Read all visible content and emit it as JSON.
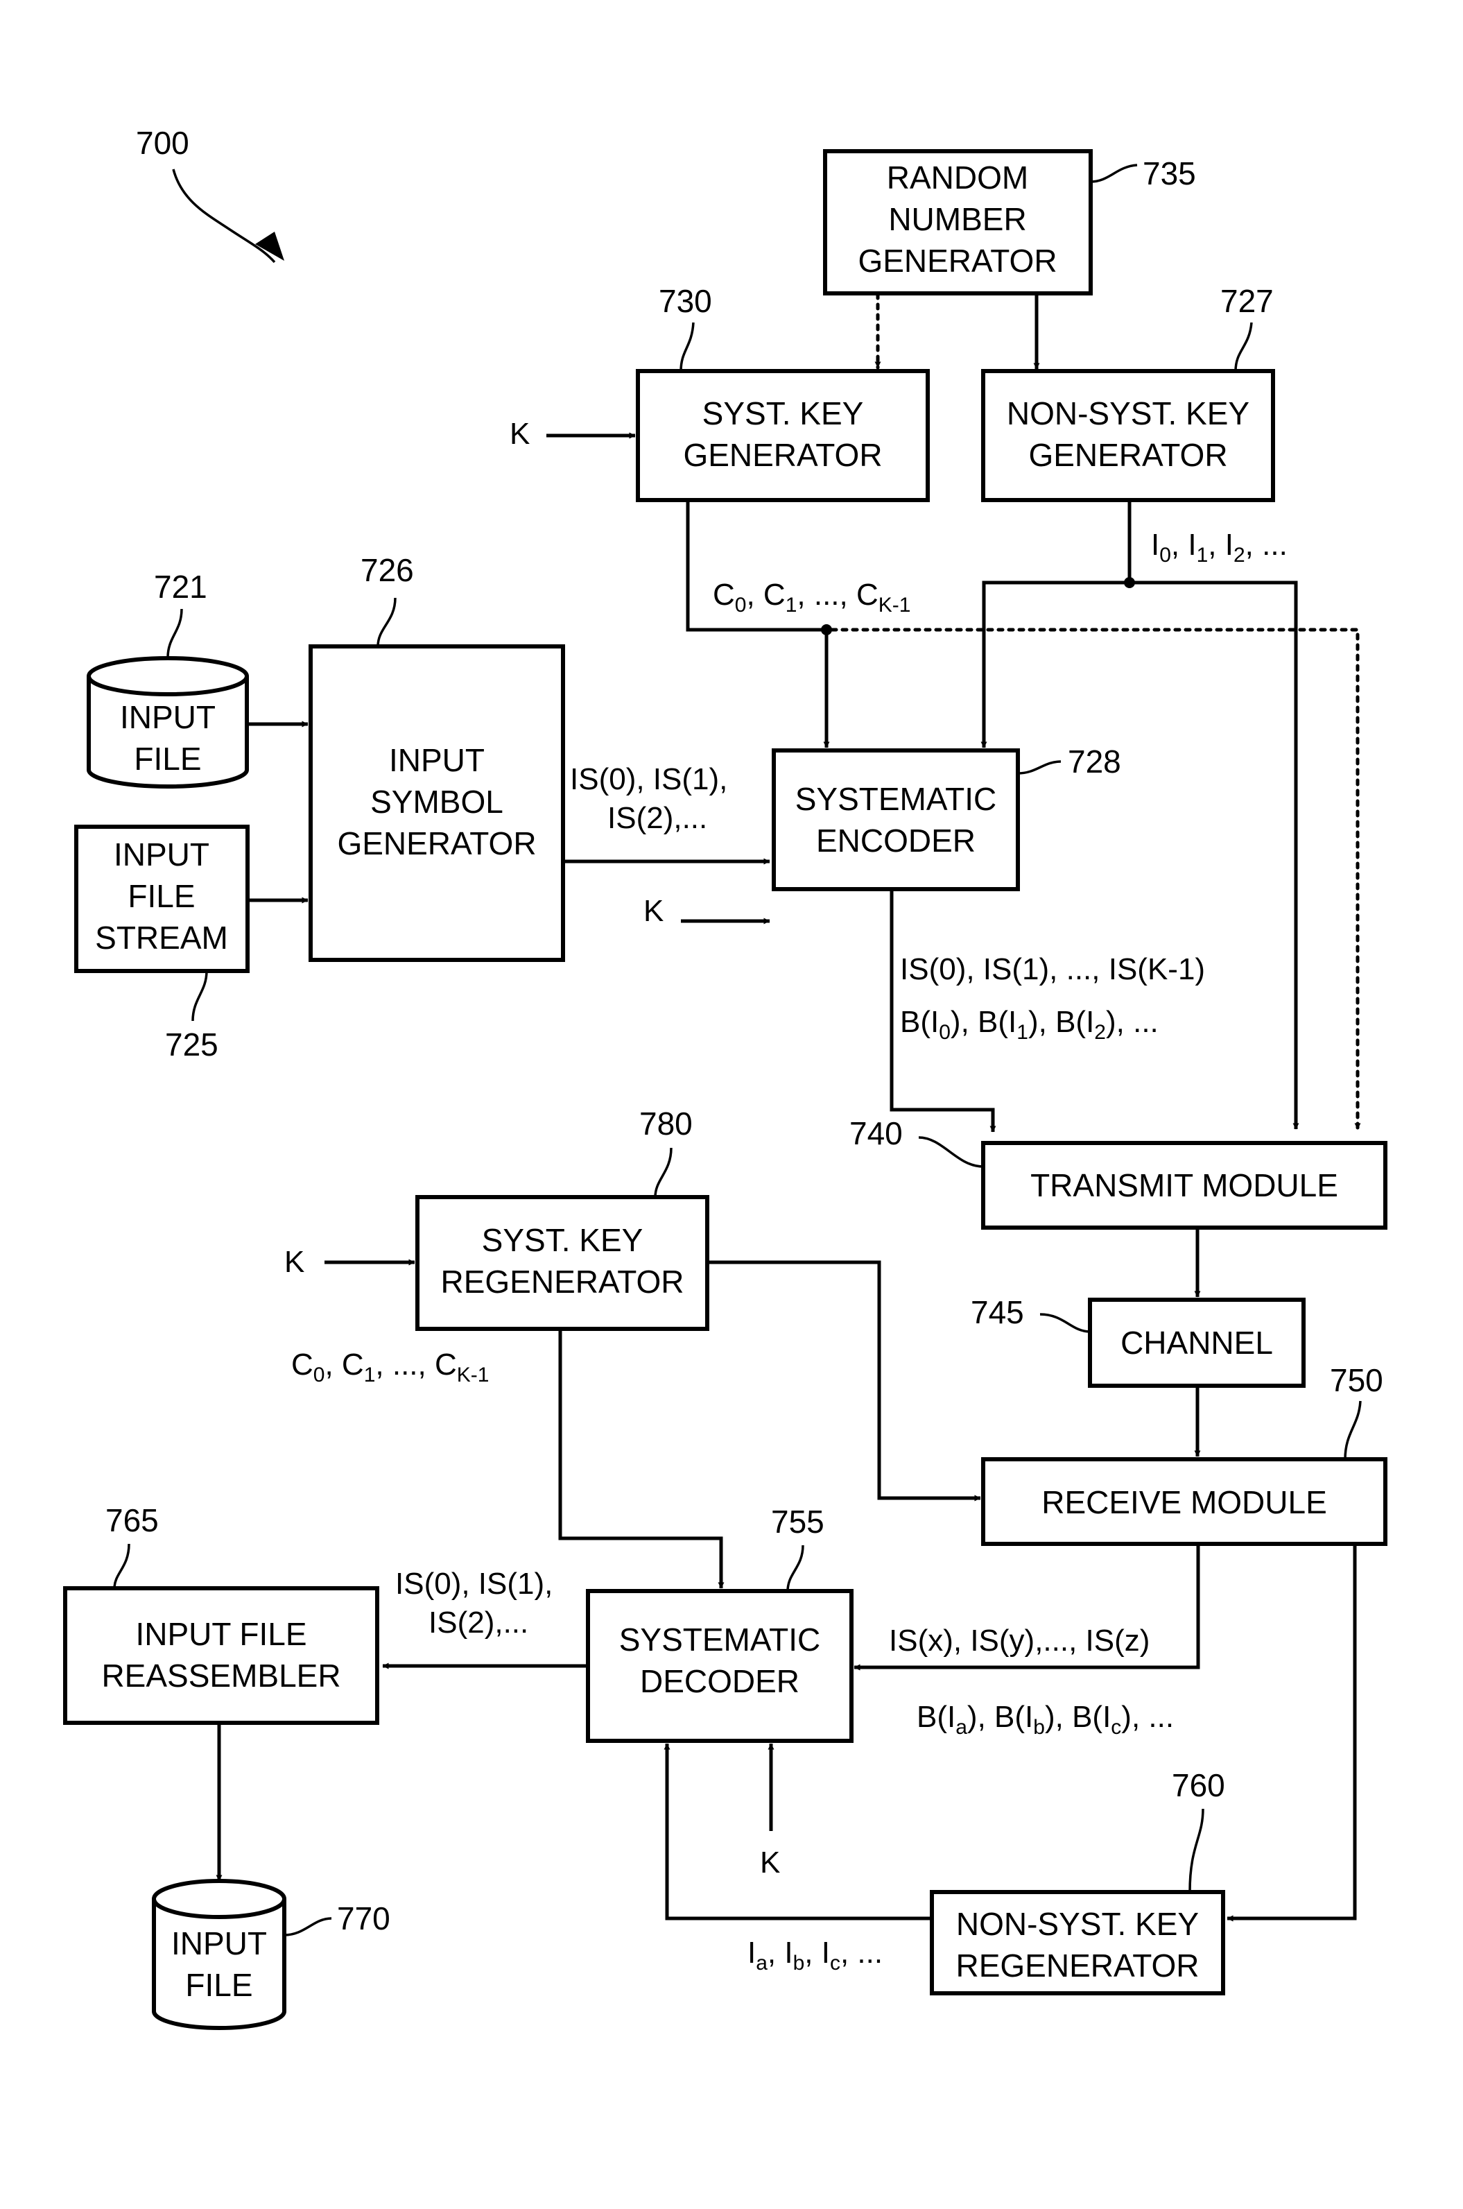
{
  "figure": {
    "ref": "700",
    "colors": {
      "ink": "#000000",
      "background": "#ffffff"
    }
  },
  "blocks": {
    "random_number_generator": {
      "ref": "735",
      "lines": [
        "RANDOM",
        "NUMBER",
        "GENERATOR"
      ]
    },
    "syst_key_generator": {
      "ref": "730",
      "lines": [
        "SYST. KEY",
        "GENERATOR"
      ]
    },
    "non_syst_key_generator": {
      "ref": "727",
      "lines": [
        "NON-SYST. KEY",
        "GENERATOR"
      ]
    },
    "input_file": {
      "ref": "721",
      "lines": [
        "INPUT",
        "FILE"
      ]
    },
    "input_file_stream": {
      "ref": "725",
      "lines": [
        "INPUT",
        "FILE",
        "STREAM"
      ]
    },
    "input_symbol_generator": {
      "ref": "726",
      "lines": [
        "INPUT",
        "SYMBOL",
        "GENERATOR"
      ]
    },
    "systematic_encoder": {
      "ref": "728",
      "lines": [
        "SYSTEMATIC",
        "ENCODER"
      ]
    },
    "transmit_module": {
      "ref": "740",
      "lines": [
        "TRANSMIT MODULE"
      ]
    },
    "channel": {
      "ref": "745",
      "lines": [
        "CHANNEL"
      ]
    },
    "receive_module": {
      "ref": "750",
      "lines": [
        "RECEIVE MODULE"
      ]
    },
    "syst_key_regenerator": {
      "ref": "780",
      "lines": [
        "SYST. KEY",
        "REGENERATOR"
      ]
    },
    "systematic_decoder": {
      "ref": "755",
      "lines": [
        "SYSTEMATIC",
        "DECODER"
      ]
    },
    "non_syst_key_regenerator": {
      "ref": "760",
      "lines": [
        "NON-SYST. KEY",
        "REGENERATOR"
      ]
    },
    "input_file_reassembler": {
      "ref": "765",
      "lines": [
        "INPUT FILE",
        "REASSEMBLER"
      ]
    },
    "output_input_file": {
      "ref": "770",
      "lines": [
        "INPUT",
        "FILE"
      ]
    }
  },
  "signals": {
    "k": "K",
    "keys_c": {
      "c": "C",
      "s0": "0",
      "s1": "1",
      "sk": "K-1",
      "sep": ", ",
      "ellipsis": ", ..., "
    },
    "keys_i": {
      "i": "I",
      "s0": "0",
      "s1": "1",
      "s2": "2",
      "tail": ", ..."
    },
    "isg_out_line1": "IS(0), IS(1),",
    "isg_out_line2": "IS(2),...",
    "enc_out_line1": "IS(0), IS(1), ..., IS(K-1)",
    "enc_out_b": {
      "b": "B(I",
      "s0": "0",
      "s1": "1",
      "s2": "2",
      "close": "), ",
      "tail": "..."
    },
    "recv_out_line1": "IS(x), IS(y),..., IS(z)",
    "recv_out_b": {
      "b": "B(I",
      "sa": "a",
      "sb": "b",
      "sc": "c",
      "close": "), ",
      "tail": "..."
    },
    "regen_i": {
      "i": "I",
      "sa": "a",
      "sb": "b",
      "sc": "c",
      "tail": ", ..."
    },
    "dec_out_line1": "IS(0), IS(1),",
    "dec_out_line2": "IS(2),..."
  }
}
